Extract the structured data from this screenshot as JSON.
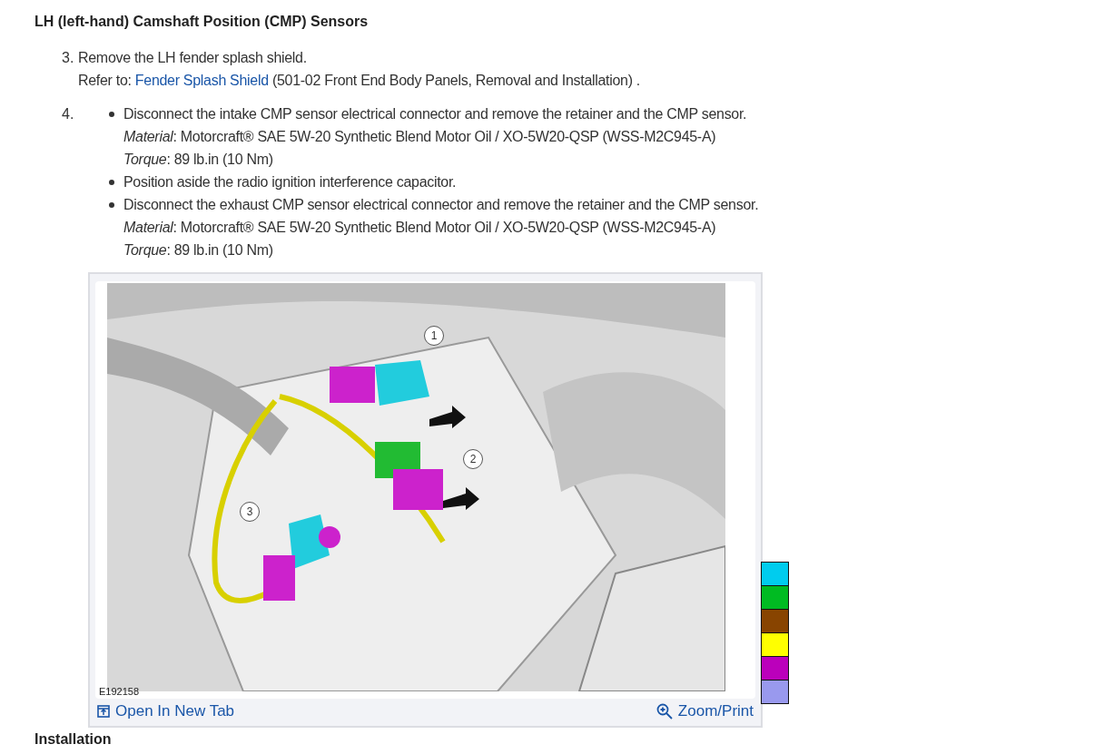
{
  "heading": "LH (left-hand) Camshaft Position (CMP) Sensors",
  "steps": [
    {
      "number": "3.",
      "kind": "text",
      "text": "Remove the LH fender splash shield.",
      "refer": {
        "lead": "Refer to: ",
        "link": "Fender Splash Shield",
        "rest": " (501-02 Front End Body Panels, Removal and Installation) ."
      }
    },
    {
      "number": "4.",
      "kind": "bullets",
      "bullets": [
        {
          "text": "Disconnect the intake CMP sensor electrical connector and remove the retainer and the CMP sensor.",
          "notes": [
            "*Material*: Motorcraft® SAE 5W-20 Synthetic Blend Motor Oil / XO-5W20-QSP (WSS-M2C945-A)",
            "*Torque*: 89 lb.in (10 Nm)"
          ]
        },
        {
          "text": "Position aside the radio ignition interference capacitor."
        },
        {
          "text": "Disconnect the exhaust CMP sensor electrical connector and remove the retainer and the CMP sensor.",
          "notes": [
            "*Material*: Motorcraft® SAE 5W-20 Synthetic Blend Motor Oil / XO-5W20-QSP (WSS-M2C945-A)",
            "*Torque*: 89 lb.in (10 Nm)"
          ]
        }
      ]
    }
  ],
  "figure": {
    "kind": "picture",
    "callouts": [
      "1",
      "2",
      "3"
    ],
    "figure_id": "E192158",
    "open_link": "Open In New Tab",
    "zoom_link": "Zoom/Print"
  },
  "legend": [
    {
      "color": "#00ccee"
    },
    {
      "color": "#00bb22"
    },
    {
      "color": "#884400"
    },
    {
      "color": "#ffff00"
    },
    {
      "color": "#bb00bb"
    },
    {
      "color": "#9999ee"
    }
  ],
  "next_heading": "Installation"
}
